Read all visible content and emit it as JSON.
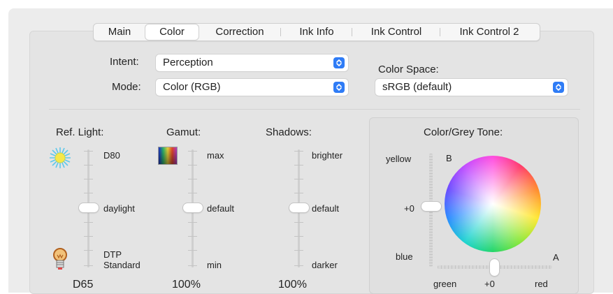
{
  "tabs": [
    {
      "label": "Main",
      "selected": false
    },
    {
      "label": "Color",
      "selected": true
    },
    {
      "label": "Correction",
      "selected": false
    },
    {
      "label": "Ink Info",
      "selected": false
    },
    {
      "label": "Ink Control",
      "selected": false
    },
    {
      "label": "Ink Control 2",
      "selected": false
    }
  ],
  "intent": {
    "label": "Intent:",
    "value": "Perception"
  },
  "mode": {
    "label": "Mode:",
    "value": "Color (RGB)"
  },
  "color_space": {
    "label": "Color Space:",
    "value": "sRGB (default)"
  },
  "ref_light": {
    "title": "Ref. Light:",
    "top": "D80",
    "middle": "daylight",
    "bottom_line1": "DTP",
    "bottom_line2": "Standard",
    "value": "D65",
    "level": 0.5
  },
  "gamut": {
    "title": "Gamut:",
    "top": "max",
    "middle": "default",
    "bottom": "min",
    "value": "100%",
    "level": 0.5
  },
  "shadows": {
    "title": "Shadows:",
    "top": "brighter",
    "middle": "default",
    "bottom": "darker",
    "value": "100%",
    "level": 0.5
  },
  "tone": {
    "title": "Color/Grey Tone:",
    "vertical": {
      "top": "yellow",
      "middle": "+0",
      "bottom": "blue",
      "axis": "B",
      "level": 0.5
    },
    "horizontal": {
      "left": "green",
      "middle": "+0",
      "right": "red",
      "axis": "A",
      "level": 0.5
    }
  },
  "colors": {
    "accent": "#2f7cf6"
  }
}
